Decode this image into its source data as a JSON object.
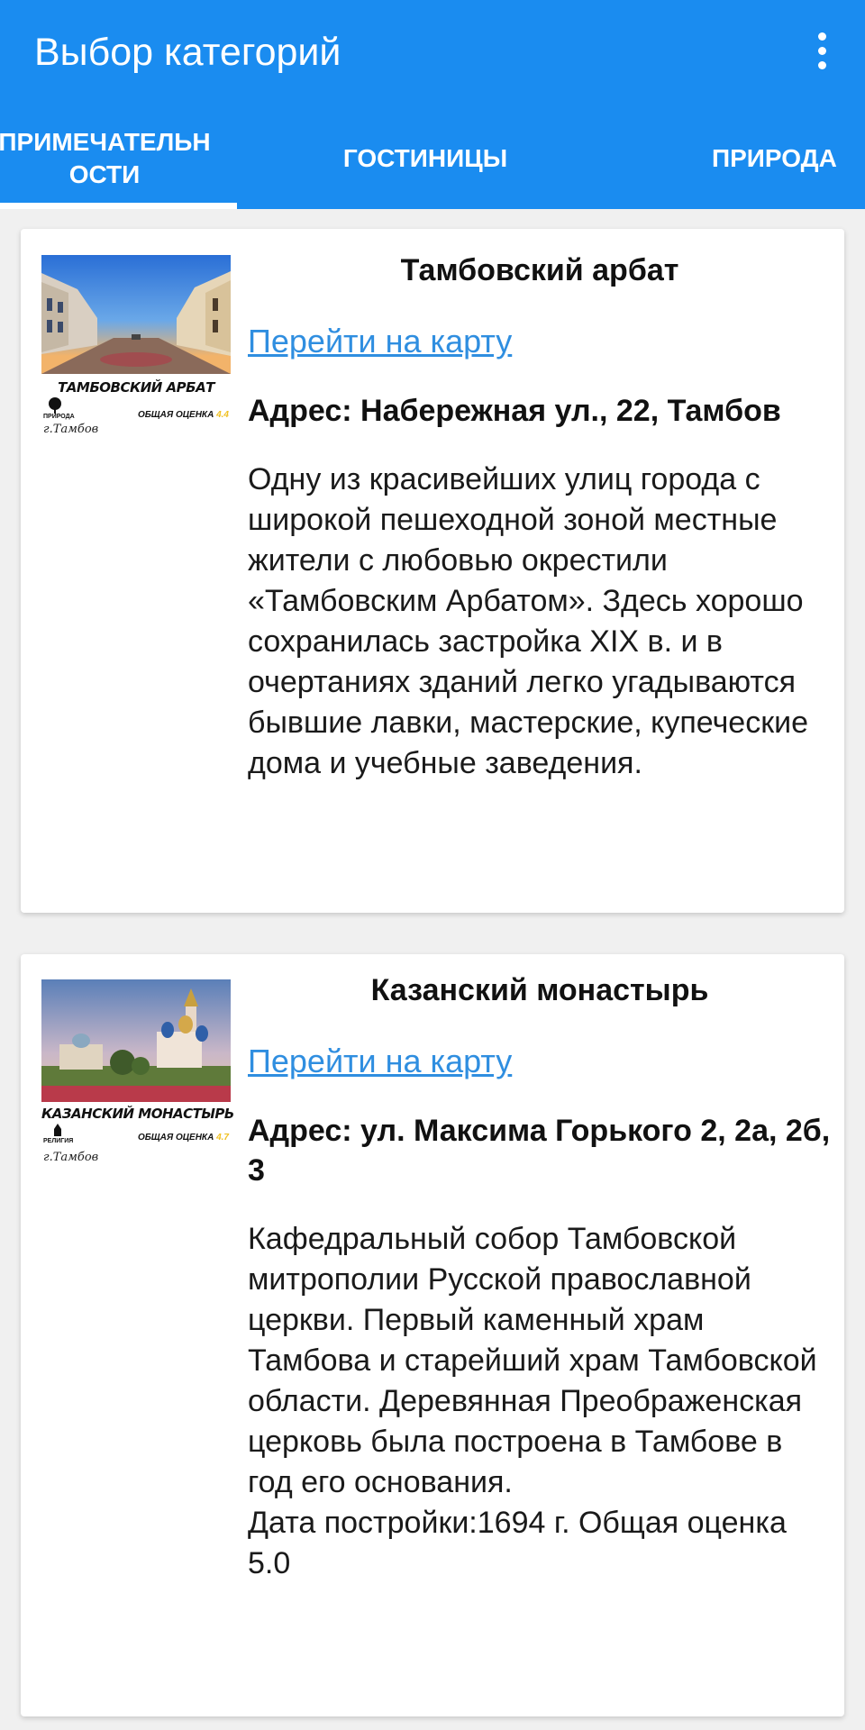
{
  "appbar": {
    "title": "Выбор категорий",
    "menu_icon": "more-vert-icon",
    "background": "#1a8cf0"
  },
  "tabs": [
    {
      "label": "ПРИМЕЧАТЕЛЬН\nОСТИ",
      "selected": true
    },
    {
      "label": "ГОСТИНИЦЫ",
      "selected": false
    },
    {
      "label": "ПРИРОДА",
      "selected": false
    }
  ],
  "places": [
    {
      "name": "Тамбовский арбат",
      "map_link": "Перейти на карту",
      "address": "Адрес: Набережная ул., 22, Тамбов",
      "description": "Одну из красивейших улиц города с широкой пешеходной зоной местные жители с любовью окрестили «Тамбовским Арбатом». Здесь хорошо сохранилась застройка XIX в. и в очертаниях зданий легко угадываются бывшие лавки, мастерские, купеческие дома и учебные заведения.",
      "thumb": {
        "title": "ТАМБОВСКИЙ АРБАТ",
        "category": "ПРИРОДА",
        "rating_label": "ОБЩАЯ ОЦЕНКА",
        "rating": "4.4",
        "city": "г.Тамбов"
      }
    },
    {
      "name": "Казанский монастырь",
      "map_link": "Перейти на карту",
      "address": "Адрес: ул. Максима Горького 2, 2а, 2б, 3",
      "description": "Кафедральный собор Тамбовской митрополии Русской православной церкви. Первый каменный храм Тамбова и старейший храм Тамбовской области. Деревянная Преображенская церковь была построена в Тамбове в год его основания.\nДата постройки:1694 г.  Общая оценка 5.0",
      "thumb": {
        "title": "КАЗАНСКИЙ МОНАСТЫРЬ",
        "category": "РЕЛИГИЯ",
        "rating_label": "ОБЩАЯ ОЦЕНКА",
        "rating": "4.7",
        "city": "г.Тамбов"
      }
    }
  ],
  "colors": {
    "link": "#2f8ee0",
    "rating": "#f0c020"
  }
}
